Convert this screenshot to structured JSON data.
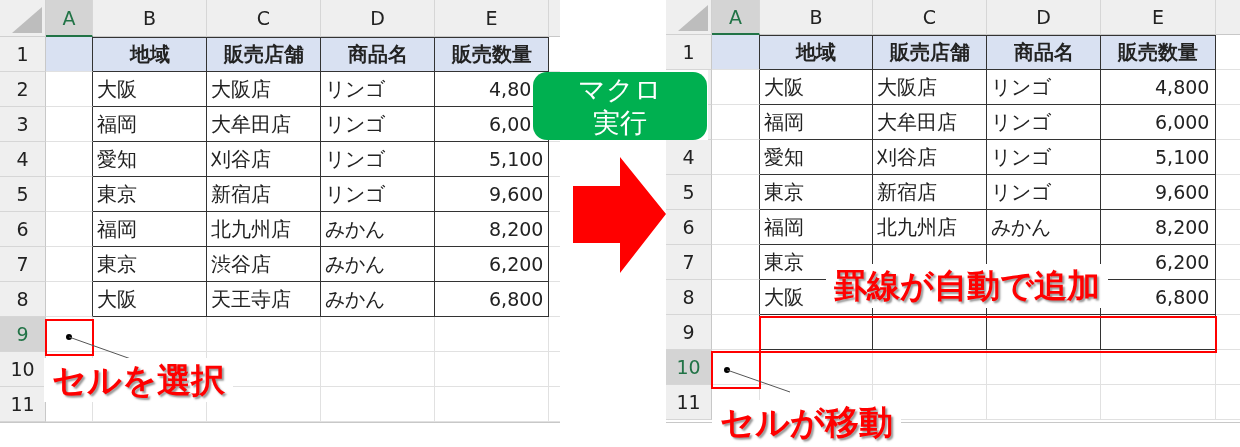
{
  "sheets": [
    {
      "columns": [
        {
          "label": "A",
          "selected": true
        },
        {
          "label": "B",
          "selected": false
        },
        {
          "label": "C",
          "selected": false
        },
        {
          "label": "D",
          "selected": false
        },
        {
          "label": "E",
          "selected": false
        }
      ],
      "rows": [
        {
          "number": "1",
          "selected": false,
          "kind": "header",
          "bordered": true,
          "cells": {
            "b": "地域",
            "c": "販売店舗",
            "d": "商品名",
            "e": "販売数量"
          }
        },
        {
          "number": "2",
          "selected": false,
          "kind": "data",
          "bordered": true,
          "cells": {
            "b": "大阪",
            "c": "大阪店",
            "d": "リンゴ",
            "e": "4,80"
          }
        },
        {
          "number": "3",
          "selected": false,
          "kind": "data",
          "bordered": true,
          "cells": {
            "b": "福岡",
            "c": "大牟田店",
            "d": "リンゴ",
            "e": "6,00"
          }
        },
        {
          "number": "4",
          "selected": false,
          "kind": "data",
          "bordered": true,
          "cells": {
            "b": "愛知",
            "c": "刈谷店",
            "d": "リンゴ",
            "e": "5,100"
          }
        },
        {
          "number": "5",
          "selected": false,
          "kind": "data",
          "bordered": true,
          "cells": {
            "b": "東京",
            "c": "新宿店",
            "d": "リンゴ",
            "e": "9,600"
          }
        },
        {
          "number": "6",
          "selected": false,
          "kind": "data",
          "bordered": true,
          "cells": {
            "b": "福岡",
            "c": "北九州店",
            "d": "みかん",
            "e": "8,200"
          }
        },
        {
          "number": "7",
          "selected": false,
          "kind": "data",
          "bordered": true,
          "cells": {
            "b": "東京",
            "c": "渋谷店",
            "d": "みかん",
            "e": "6,200"
          }
        },
        {
          "number": "8",
          "selected": false,
          "kind": "data",
          "bordered": true,
          "cells": {
            "b": "大阪",
            "c": "天王寺店",
            "d": "みかん",
            "e": "6,800"
          }
        },
        {
          "number": "9",
          "selected": true,
          "kind": "data",
          "bordered": false
        },
        {
          "number": "10",
          "selected": false,
          "kind": "data",
          "bordered": false
        },
        {
          "number": "11",
          "selected": false,
          "kind": "data",
          "bordered": false
        }
      ]
    },
    {
      "columns": [
        {
          "label": "A",
          "selected": true
        },
        {
          "label": "B",
          "selected": false
        },
        {
          "label": "C",
          "selected": false
        },
        {
          "label": "D",
          "selected": false
        },
        {
          "label": "E",
          "selected": false
        }
      ],
      "rows": [
        {
          "number": "1",
          "selected": false,
          "kind": "header",
          "bordered": true,
          "cells": {
            "b": "地域",
            "c": "販売店舗",
            "d": "商品名",
            "e": "販売数量"
          }
        },
        {
          "selected": false,
          "kind": "data",
          "bordered": true,
          "cells": {
            "b": "大阪",
            "c": "大阪店",
            "d": "リンゴ",
            "e": "4,800"
          }
        },
        {
          "selected": false,
          "kind": "data",
          "bordered": true,
          "cells": {
            "b": "福岡",
            "c": "大牟田店",
            "d": "リンゴ",
            "e": "6,000"
          }
        },
        {
          "number": "4",
          "selected": false,
          "kind": "data",
          "bordered": true,
          "cells": {
            "b": "愛知",
            "c": "刈谷店",
            "d": "リンゴ",
            "e": "5,100"
          }
        },
        {
          "number": "5",
          "selected": false,
          "kind": "data",
          "bordered": true,
          "cells": {
            "b": "東京",
            "c": "新宿店",
            "d": "リンゴ",
            "e": "9,600"
          }
        },
        {
          "number": "6",
          "selected": false,
          "kind": "data",
          "bordered": true,
          "cells": {
            "b": "福岡",
            "c": "北九州店",
            "d": "みかん",
            "e": "8,200"
          }
        },
        {
          "number": "7",
          "selected": false,
          "kind": "data",
          "bordered": true,
          "cells": {
            "b": "東京",
            "e": "6,200"
          }
        },
        {
          "number": "8",
          "selected": false,
          "kind": "data",
          "bordered": true,
          "cells": {
            "b": "大阪",
            "e": "6,800"
          }
        },
        {
          "number": "9",
          "selected": false,
          "kind": "data",
          "bordered": true
        },
        {
          "number": "10",
          "selected": true,
          "kind": "data",
          "bordered": false
        },
        {
          "number": "11",
          "selected": false,
          "kind": "data",
          "bordered": false
        }
      ]
    }
  ],
  "badge": {
    "lines": [
      "マクロ",
      "実行"
    ]
  },
  "callouts": [
    {
      "text": "セルを選択"
    },
    {
      "text": "罫線が自動で追加"
    },
    {
      "text": "セルが移動"
    }
  ]
}
